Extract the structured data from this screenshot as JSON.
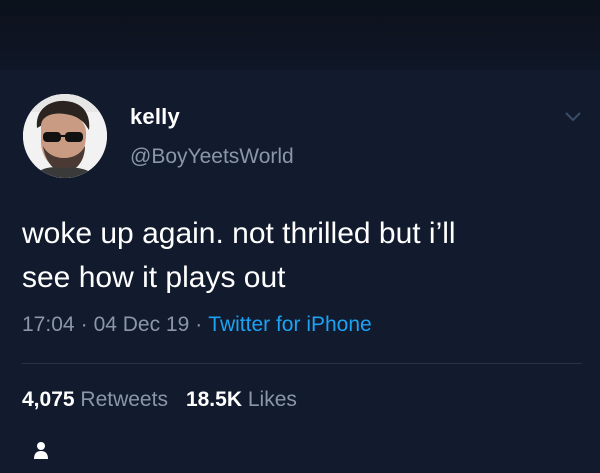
{
  "tweet": {
    "author_name": "kelly",
    "handle": "@BoyYeetsWorld",
    "text": "woke up again.  not thrilled but i’ll\nsee how it plays out",
    "time": "17:04",
    "date": "04 Dec 19",
    "separator": "·",
    "source": "Twitter for iPhone",
    "retweets_count": "4,075",
    "retweets_label": "Retweets",
    "likes_count": "18.5K",
    "likes_label": "Likes"
  },
  "icons": {
    "more": "chevron-down-icon",
    "tagged_user": "user-icon",
    "avatar": "avatar"
  },
  "colors": {
    "background": "#111b2d",
    "text": "#ffffff",
    "muted": "#8a97a8",
    "link": "#1da1f2"
  }
}
